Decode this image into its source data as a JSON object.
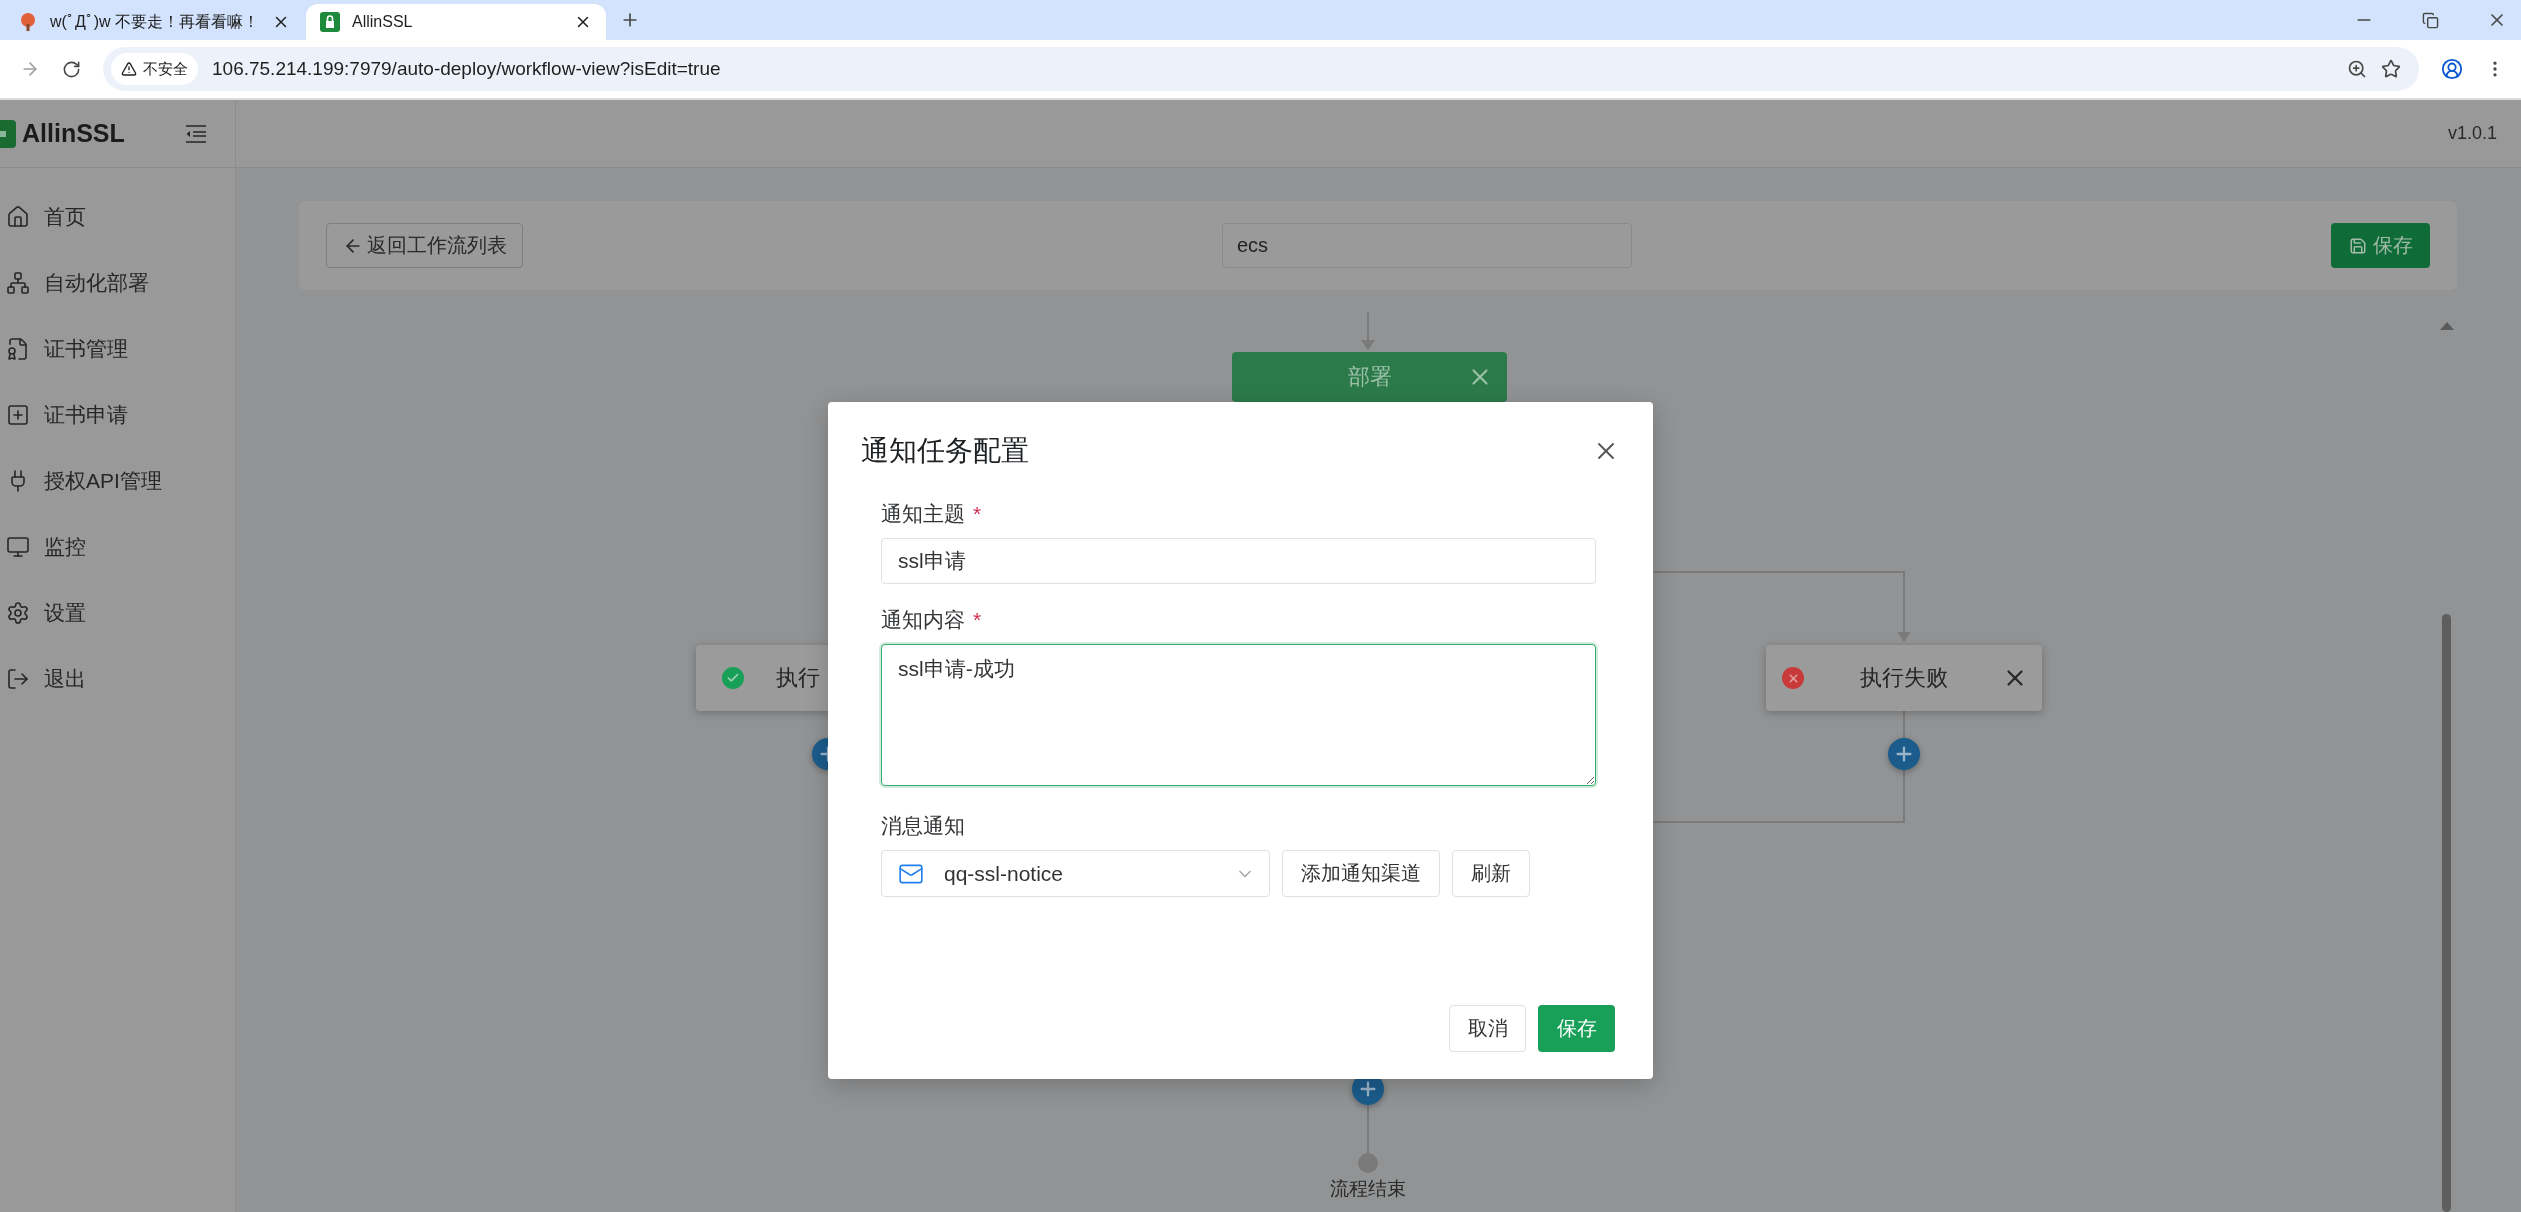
{
  "browser": {
    "tabs": [
      {
        "title": "w(ﾟДﾟ)w 不要走！再看看嘛！",
        "selected": false
      },
      {
        "title": "AllinSSL",
        "selected": true
      }
    ],
    "security_label": "不安全",
    "url": "106.75.214.199:7979/auto-deploy/workflow-view?isEdit=true"
  },
  "sidebar": {
    "brand": "AllinSSL",
    "items": [
      {
        "kind": "home",
        "label": "首页"
      },
      {
        "kind": "deploy",
        "label": "自动化部署"
      },
      {
        "kind": "cert",
        "label": "证书管理"
      },
      {
        "kind": "apply",
        "label": "证书申请"
      },
      {
        "kind": "api",
        "label": "授权API管理"
      },
      {
        "kind": "monitor",
        "label": "监控"
      },
      {
        "kind": "settings",
        "label": "设置"
      },
      {
        "kind": "logout",
        "label": "退出"
      }
    ]
  },
  "header": {
    "version": "v1.0.1"
  },
  "toolbar": {
    "back_button": "返回工作流列表",
    "workflow_name": "ecs",
    "save_button": "保存"
  },
  "canvas": {
    "nodes": [
      {
        "kind": "deploy",
        "label": "部署"
      },
      {
        "kind": "success",
        "label": "执行"
      },
      {
        "kind": "fail",
        "label": "执行失败"
      }
    ],
    "end_label": "流程结束"
  },
  "dialog": {
    "title": "通知任务配置",
    "fields": [
      {
        "kind": "input",
        "label": "通知主题",
        "required_mark": "*",
        "value": "ssl申请",
        "focused": false
      },
      {
        "kind": "textarea",
        "label": "通知内容",
        "required_mark": "*",
        "value": "ssl申请-成功",
        "focused": true
      },
      {
        "kind": "select",
        "label": "消息通知",
        "value": "qq-ssl-notice",
        "buttons": [
          "添加通知渠道",
          "刷新"
        ]
      }
    ],
    "buttons": [
      {
        "kind": "secondary",
        "label": "取消"
      },
      {
        "kind": "primary",
        "label": "保存"
      }
    ]
  }
}
